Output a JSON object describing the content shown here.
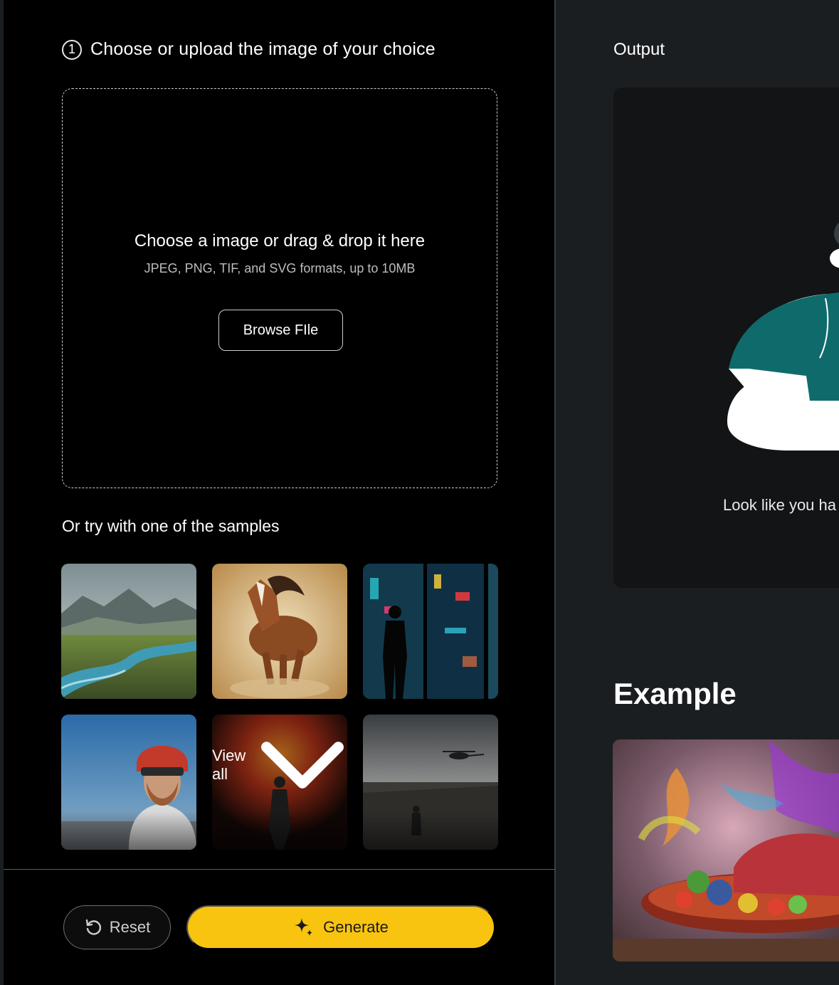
{
  "upload": {
    "step_number": "1",
    "step_title": "Choose or upload the image of your choice",
    "dropzone_title": "Choose a image or drag & drop it here",
    "dropzone_subtitle": "JPEG, PNG, TIF, and SVG formats, up to 10MB",
    "browse_label": "Browse FIle"
  },
  "samples": {
    "title": "Or try with one of the samples",
    "view_all_label": "View all",
    "items": [
      {
        "icon": "landscape-river-thumbnail"
      },
      {
        "icon": "galloping-horse-thumbnail"
      },
      {
        "icon": "neon-city-figure-thumbnail"
      },
      {
        "icon": "astronaut-red-helmet-thumbnail"
      },
      {
        "icon": "fiery-explosion-astronaut-thumbnail"
      },
      {
        "icon": "helicopter-wasteland-thumbnail"
      }
    ]
  },
  "actions": {
    "reset_label": "Reset",
    "generate_label": "Generate"
  },
  "output": {
    "title": "Output",
    "empty_message": "Look like you ha"
  },
  "example": {
    "title": "Example"
  },
  "colors": {
    "accent": "#f8c410",
    "left_bg": "#000000",
    "right_bg": "#1b1e20",
    "illustration_shirt": "#0f6b6b"
  }
}
